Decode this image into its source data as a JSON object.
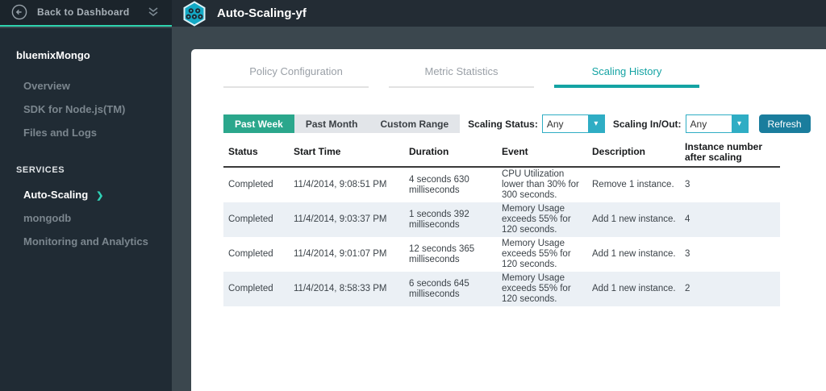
{
  "topbar": {
    "back_label": "Back to Dashboard",
    "app_title": "Auto-Scaling-yf"
  },
  "sidebar": {
    "app_name": "bluemixMongo",
    "items": [
      {
        "label": "Overview"
      },
      {
        "label": "SDK for Node.js(TM)"
      },
      {
        "label": "Files and Logs"
      }
    ],
    "section_label": "SERVICES",
    "services": [
      {
        "label": "Auto-Scaling",
        "active": true
      },
      {
        "label": "mongodb"
      },
      {
        "label": "Monitoring and Analytics"
      }
    ]
  },
  "tabs": [
    {
      "label": "Policy Configuration",
      "active": false
    },
    {
      "label": "Metric Statistics",
      "active": false
    },
    {
      "label": "Scaling History",
      "active": true
    }
  ],
  "filters": {
    "range_buttons": [
      {
        "label": "Past Week",
        "active": true
      },
      {
        "label": "Past Month",
        "active": false
      },
      {
        "label": "Custom Range",
        "active": false
      }
    ],
    "scaling_status_label": "Scaling Status:",
    "scaling_status_value": "Any",
    "scaling_inout_label": "Scaling In/Out:",
    "scaling_inout_value": "Any",
    "refresh_label": "Refresh"
  },
  "table": {
    "columns": [
      "Status",
      "Start Time",
      "Duration",
      "Event",
      "Description",
      "Instance number after scaling"
    ],
    "rows": [
      {
        "status": "Completed",
        "start_time": "11/4/2014, 9:08:51 PM",
        "duration": "4 seconds 630 milliseconds",
        "event": "CPU Utilization lower than 30% for 300 seconds.",
        "description": "Remove 1 instance.",
        "instances_after": "3"
      },
      {
        "status": "Completed",
        "start_time": "11/4/2014, 9:03:37 PM",
        "duration": "1 seconds 392 milliseconds",
        "event": "Memory Usage exceeds 55% for 120 seconds.",
        "description": "Add 1 new instance.",
        "instances_after": "4"
      },
      {
        "status": "Completed",
        "start_time": "11/4/2014, 9:01:07 PM",
        "duration": "12 seconds 365 milliseconds",
        "event": "Memory Usage exceeds 55% for 120 seconds.",
        "description": "Add 1 new instance.",
        "instances_after": "3"
      },
      {
        "status": "Completed",
        "start_time": "11/4/2014, 8:58:33 PM",
        "duration": "6 seconds 645 milliseconds",
        "event": "Memory Usage exceeds 55% for 120 seconds.",
        "description": "Add 1 new instance.",
        "instances_after": "2"
      }
    ]
  },
  "icons": {
    "select_chevron": "▾",
    "sidebar_active_chevron": "❯"
  },
  "colors": {
    "topbar_left_bg": "#1b242b",
    "topbar_right_bg": "#232c34",
    "sidebar_bg": "#202b34",
    "content_bg": "#3b474e",
    "accent_teal_line": "#2ed3ae",
    "active_tab_teal": "#14a3a3",
    "primary_button_teal": "#2ba78c",
    "refresh_button_blue": "#1a7d9d",
    "select_accent": "#2fadc4",
    "row_alt_bg": "#ebf0f5",
    "hexagon_icon_fill": "#13a9c5"
  }
}
